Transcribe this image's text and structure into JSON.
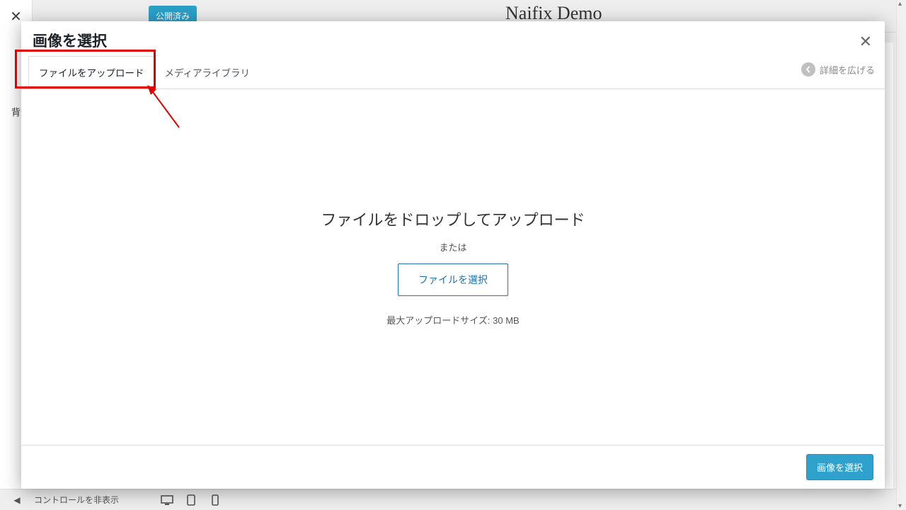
{
  "background": {
    "publish_button": "公開済み",
    "site_title": "Naifix Demo",
    "side_label": "背景",
    "bottom_hide_controls": "コントロールを非表示"
  },
  "modal": {
    "title": "画像を選択",
    "close_label": "✕",
    "tabs": {
      "upload": "ファイルをアップロード",
      "library": "メディアライブラリ"
    },
    "expand_details": "詳細を広げる",
    "drop_title": "ファイルをドロップしてアップロード",
    "or_text": "または",
    "select_file_button": "ファイルを選択",
    "max_upload_size": "最大アップロードサイズ: 30 MB",
    "footer_select_image": "画像を選択"
  }
}
